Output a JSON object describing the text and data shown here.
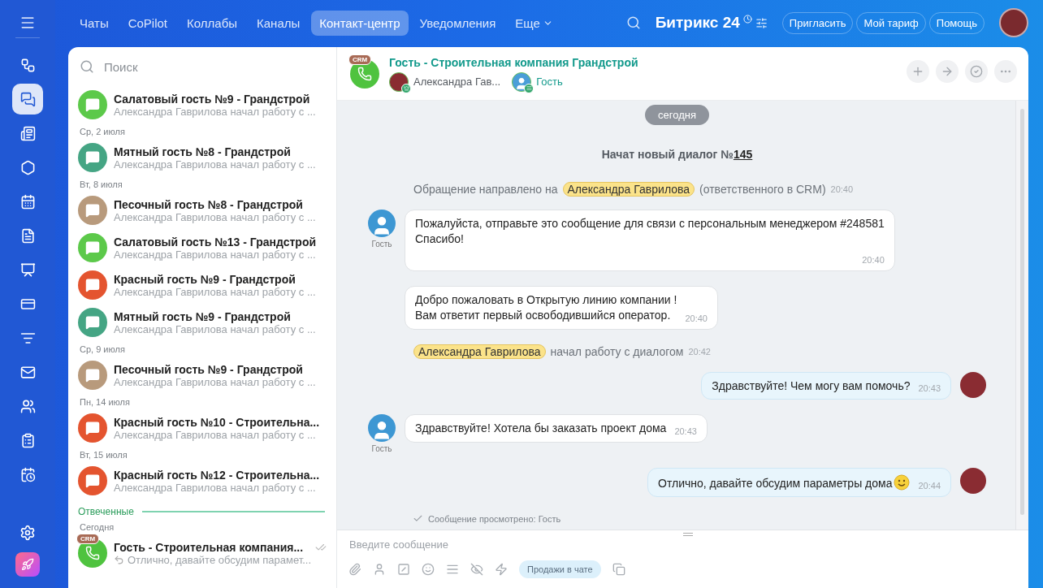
{
  "rail": {
    "items": [
      {
        "selected": false
      },
      {
        "selected": true
      },
      {
        "selected": false
      },
      {
        "selected": false
      },
      {
        "selected": false
      },
      {
        "selected": false
      },
      {
        "selected": false
      },
      {
        "selected": false
      },
      {
        "selected": false
      },
      {
        "selected": false
      },
      {
        "selected": false
      },
      {
        "selected": false
      },
      {
        "selected": false
      }
    ]
  },
  "nav": {
    "tabs": [
      {
        "label": "Чаты",
        "selected": false
      },
      {
        "label": "CoPilot",
        "selected": false
      },
      {
        "label": "Коллабы",
        "selected": false
      },
      {
        "label": "Каналы",
        "selected": false
      },
      {
        "label": "Контакт-центр",
        "selected": true
      },
      {
        "label": "Уведомления",
        "selected": false
      }
    ],
    "more": "Еще",
    "logo": "Битрикс 24",
    "buttons": [
      "Пригласить",
      "Мой тариф",
      "Помощь"
    ]
  },
  "chat_list": {
    "search": {
      "placeholder": "Поиск"
    },
    "items": [
      {
        "kind": "chat",
        "title": "Салатовый гость №9 - Грандстрой",
        "preview": "Александра Гаврилова начал работу с ...",
        "color": "#5cc94a"
      },
      {
        "kind": "date",
        "text": "Ср, 2 июля"
      },
      {
        "kind": "chat",
        "title": "Мятный гость №8 - Грандстрой",
        "preview": "Александра Гаврилова начал работу с ...",
        "color": "#45a584"
      },
      {
        "kind": "date",
        "text": "Вт, 8 июля"
      },
      {
        "kind": "chat",
        "title": "Песочный гость №8 - Грандстрой",
        "preview": "Александра Гаврилова начал работу с ...",
        "color": "#b89a7c"
      },
      {
        "kind": "chat",
        "title": "Салатовый гость №13 - Грандстрой",
        "preview": "Александра Гаврилова начал работу с ...",
        "color": "#5cc94a"
      },
      {
        "kind": "chat",
        "title": "Красный гость №9 - Грандстрой",
        "preview": "Александра Гаврилова начал работу с ...",
        "color": "#e4542f"
      },
      {
        "kind": "chat",
        "title": "Мятный гость №9 - Грандстрой",
        "preview": "Александра Гаврилова начал работу с ...",
        "color": "#45a584"
      },
      {
        "kind": "date",
        "text": "Ср, 9 июля"
      },
      {
        "kind": "chat",
        "title": "Песочный гость №9 - Грандстрой",
        "preview": "Александра Гаврилова начал работу с ...",
        "color": "#b89a7c"
      },
      {
        "kind": "date",
        "text": "Пн, 14 июля"
      },
      {
        "kind": "chat",
        "title": "Красный гость №10 - Строительна...",
        "preview": "Александра Гаврилова начал работу с ...",
        "color": "#e4542f"
      },
      {
        "kind": "date",
        "text": "Вт, 15 июля"
      },
      {
        "kind": "chat",
        "title": "Красный гость №12 - Строительна...",
        "preview": "Александра Гаврилова начал работу с ...",
        "color": "#e4542f"
      },
      {
        "kind": "section",
        "text": "Отвеченные"
      },
      {
        "kind": "date",
        "text": "Сегодня"
      },
      {
        "kind": "crm_chat",
        "badge": "CRM",
        "title": "Гость - Строительная компания...",
        "preview": "Отлично, давайте обсудим парамет..."
      }
    ]
  },
  "chat": {
    "header": {
      "badge": "CRM",
      "title": "Гость - Строительная компания Грандстрой",
      "members": [
        {
          "kind": "operator",
          "name": "Александра Гав..."
        },
        {
          "kind": "guest",
          "name": "Гость"
        }
      ]
    },
    "messages": [
      {
        "kind": "date",
        "text": "сегодня"
      },
      {
        "kind": "title",
        "text": "Начат новый диалог №",
        "link": "145"
      },
      {
        "kind": "notice",
        "before": "Обращение направлено на",
        "mention": "Александра Гаврилова",
        "after": "(ответственного в CRM)",
        "time": "20:40"
      },
      {
        "kind": "incoming",
        "author": "Гость",
        "text": "Пожалуйста, отправьте это сообщение для связи с персональным менеджером #248581\nСпасибо!",
        "time": "20:40",
        "time_below": true
      },
      {
        "kind": "incoming",
        "text": "Добро пожаловать в Открытую линию компании !\nВам ответит первый освободившийся оператор.",
        "time": "20:40",
        "time_below": false
      },
      {
        "kind": "notice",
        "mention": "Александра Гаврилова",
        "after": "начал работу с диалогом",
        "time": "20:42"
      },
      {
        "kind": "outgoing",
        "text": "Здравствуйте! Чем могу вам помочь?",
        "time": "20:43",
        "emoji": false
      },
      {
        "kind": "incoming",
        "author": "Гость",
        "text": "Здравствуйте! Хотела бы заказать проект дома",
        "time": "20:43",
        "time_below": false
      },
      {
        "kind": "outgoing",
        "text": "Отлично, давайте обсудим параметры дома",
        "time": "20:44",
        "emoji": true
      },
      {
        "kind": "read",
        "text": "Сообщение просмотрено: Гость"
      }
    ],
    "composer": {
      "placeholder": "Введите сообщение",
      "chip": "Продажи в чате"
    }
  }
}
